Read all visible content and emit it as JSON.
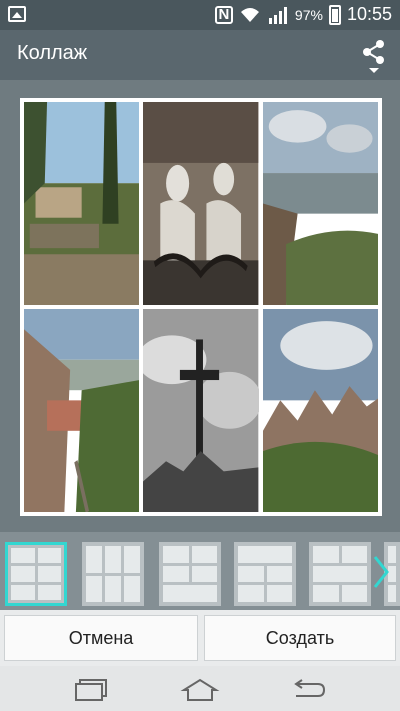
{
  "status_bar": {
    "battery_percent": "97%",
    "time": "10:55",
    "icons": [
      "image-notification-icon",
      "nfc-icon",
      "wifi-icon",
      "signal-icon",
      "battery-icon"
    ]
  },
  "action_bar": {
    "title": "Коллаж",
    "share_icon": "share-icon"
  },
  "collage": {
    "layout": "3x2 grid",
    "photos": [
      {
        "subject": "monastery-buildings"
      },
      {
        "subject": "sculpture-group"
      },
      {
        "subject": "mountain-landscape"
      },
      {
        "subject": "monastery-valley"
      },
      {
        "subject": "iron-cross-bw"
      },
      {
        "subject": "rocky-peaks"
      }
    ]
  },
  "layout_strip": {
    "options": [
      "grid-2x3",
      "grid-3x2",
      "grid-mixed-a",
      "grid-mixed-b",
      "grid-mixed-c",
      "grid-partial"
    ],
    "selected_index": 0,
    "next_icon": "chevron-right-icon"
  },
  "buttons": {
    "cancel_label": "Отмена",
    "create_label": "Создать"
  },
  "nav_bar": {
    "icons": [
      "recent-apps-icon",
      "home-icon",
      "back-icon"
    ]
  },
  "colors": {
    "accent": "#32d7d1",
    "status_bar": "#4a575d",
    "action_bar": "#5a676e"
  }
}
